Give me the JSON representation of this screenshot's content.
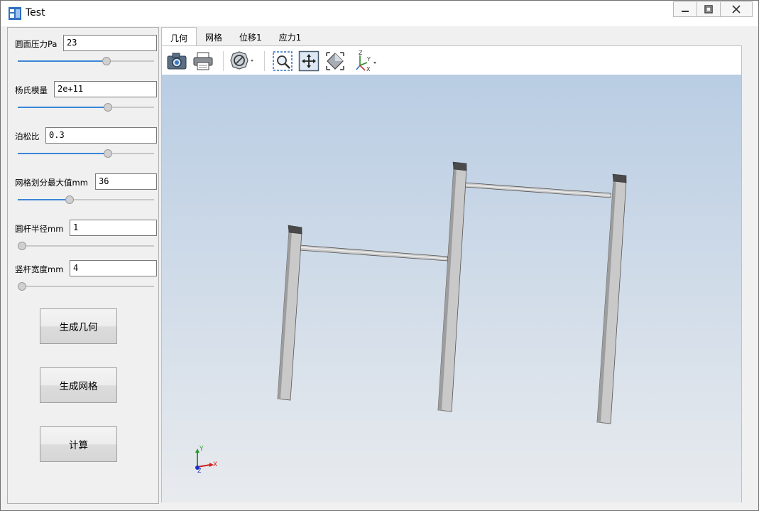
{
  "window": {
    "title": "Test",
    "icons": {
      "app": "app-icon",
      "minimize": "minimize-icon",
      "maximize": "maximize-icon",
      "close": "close-icon"
    }
  },
  "params": [
    {
      "label": "圆面压力Pa",
      "value": "23",
      "slider_fraction": 0.66
    },
    {
      "label": "杨氏模量",
      "value": "2e+11",
      "slider_fraction": 0.67
    },
    {
      "label": "泊松比",
      "value": "0.3",
      "slider_fraction": 0.67
    },
    {
      "label": "网格划分最大值mm",
      "value": "36",
      "slider_fraction": 0.37
    },
    {
      "label": "圆杆半径mm",
      "value": "1",
      "slider_fraction": 0.0
    },
    {
      "label": "竖杆宽度mm",
      "value": "4",
      "slider_fraction": 0.0
    }
  ],
  "buttons": {
    "generate_geometry": "生成几何",
    "generate_mesh": "生成网格",
    "compute": "计算"
  },
  "tabs": [
    {
      "label": "几何",
      "active": true
    },
    {
      "label": "网格",
      "active": false
    },
    {
      "label": "位移1",
      "active": false
    },
    {
      "label": "应力1",
      "active": false
    }
  ],
  "toolbar": {
    "icons": [
      "camera-icon",
      "print-icon",
      "clip-icon",
      "zoom-box-icon",
      "zoom-fit-icon",
      "pan-icon",
      "axis-view-icon"
    ]
  },
  "axis_triad": {
    "x": "X",
    "y": "Y",
    "z": "Z"
  },
  "toolbar_axis_labels": {
    "z": "Z",
    "y": "Y",
    "x": "X"
  },
  "colors": {
    "accent": "#3a86d8",
    "viewport_top": "#b9cde3",
    "viewport_bottom": "#e8ebee",
    "post": "#c8c8c8",
    "post_cap": "#505050"
  }
}
